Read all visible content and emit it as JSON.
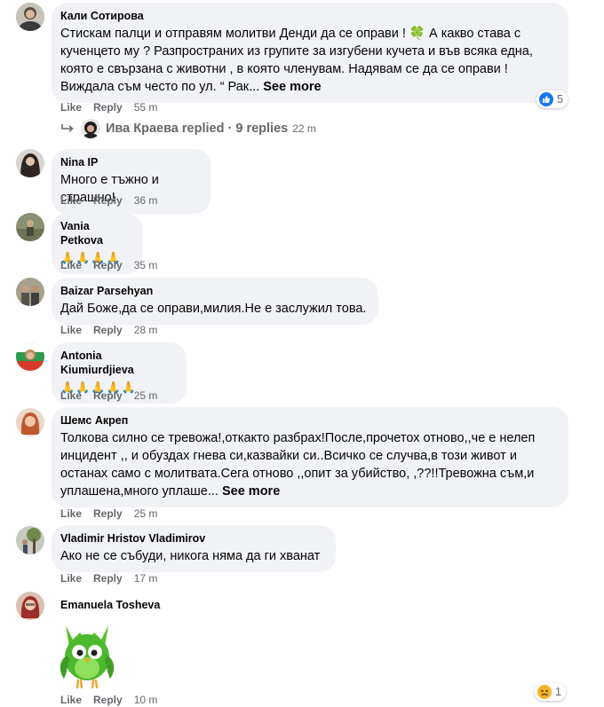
{
  "comments": [
    {
      "author": "Кали Сотирова",
      "text": "Стискам палци и отправям молитви Денди да се оправи ! 🍀 А какво става с кученцето му ? Разпространих из групите за изгубени кучета и във всяка една, която е свързана с животни , в която членувам. Надявам се да се оправи ! Виждала съм често по ул. “ Рак...",
      "see_more": "See more",
      "like": "Like",
      "reply": "Reply",
      "time": "55 m",
      "reaction_count": "5",
      "reaction_icon": "like-icon"
    },
    {
      "author": "Nina IP",
      "text": "Много е тъжно и страшно!",
      "like": "Like",
      "reply": "Reply",
      "time": "36 m"
    },
    {
      "author": "Vania Petkova",
      "text": "🙏🙏🙏🙏",
      "like": "Like",
      "reply": "Reply",
      "time": "35 m"
    },
    {
      "author": "Baizar Parsehyan",
      "text": "Дай Боже,да се оправи,милия.Не е заслужил това.",
      "like": "Like",
      "reply": "Reply",
      "time": "28 m"
    },
    {
      "author": "Antonia Kiumiurdjieva",
      "text": "🙏🙏🙏🙏🙏",
      "like": "Like",
      "reply": "Reply",
      "time": "25 m"
    },
    {
      "author": "Шемс Акреп",
      "text": "Толкова силно се тревожа!,откакто разбрах!После,прочетох отново,,че е нелеп инцидент ,, и обуздах гнева си,казвайки си..Всичко се случва,в този живот и останах само с молитвата.Сега отново ,,опит за убийство, ,??!!Тревожна съм,и уплашена,много уплаше...",
      "see_more": "See more",
      "like": "Like",
      "reply": "Reply",
      "time": "25 m"
    },
    {
      "author": "Vladimir Hristov Vladimirov",
      "text": "Ако не се събуди, никога няма да ги хванат",
      "like": "Like",
      "reply": "Reply",
      "time": "17 m"
    },
    {
      "author": "Emanuela Tosheva",
      "sticker": "green-owl-sticker",
      "like": "Like",
      "reply": "Reply",
      "time": "10 m",
      "reaction_count": "1",
      "reaction_icon": "sad-face-icon"
    }
  ],
  "replies": {
    "author": "Ива Краева",
    "action": "replied",
    "separator": "·",
    "count_label": "9 replies",
    "time": "22 m"
  },
  "colors": {
    "bubble": "#f0f2f5",
    "secondary_text": "#65676b",
    "like_blue": "#1877f2",
    "sad_yellow": "#f7b125",
    "owl_green": "#4bb82d"
  }
}
